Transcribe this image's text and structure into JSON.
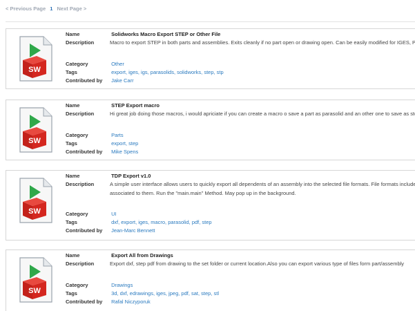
{
  "pagination": {
    "prev_label": "< Previous Page",
    "current_page": "1",
    "next_label": "Next Page >"
  },
  "labels": {
    "name": "Name",
    "description": "Description",
    "category": "Category",
    "tags": "Tags",
    "contributed_by": "Contributed by"
  },
  "icon": {
    "name": "solidworks-file-icon",
    "badge_text": "SW",
    "badge_color": "#d4271f",
    "play_color": "#2fa84a"
  },
  "items": [
    {
      "name": "Solidworks Macro Export STEP or Other File",
      "description": "Macro to export STEP in both parts and assemblies. Exits cleanly if no part open or drawing open. Can be easily modified for IGES, Parasol",
      "category": "Other",
      "tags": "export, iges, igs, parasolids, solidworks, step, stp",
      "contributor": "Jake Carr"
    },
    {
      "name": "STEP Export macro",
      "description": "Hi great job doing those macros, i would apriciate if you can create a macro o save a part as parasolid and an other one to save as step. tha",
      "category": "Parts",
      "tags": "export, step",
      "contributor": "Mike Spens"
    },
    {
      "name": "TDP Export v1.0",
      "description": "A simple user interface allows users to quickly export all dependents of an assembly into the selected file formats. File formats include pdfs, associated to them. Run the \"main.main\" Method. May pop up in the background.",
      "category": "UI",
      "tags": "dxf, export, iges, macro, parasolid, pdf, step",
      "contributor": "Jean-Marc Bennett"
    },
    {
      "name": "Export All from Drawings",
      "description": "Export dxf, step pdf from drawing to the set folder or current location.Also you can export various type of files form part/assembly",
      "category": "Drawings",
      "tags": "3d, dxf, edrawings, iges, jpeg, pdf, sat, step, stl",
      "contributor": "Rafal Niczyporuk"
    }
  ]
}
